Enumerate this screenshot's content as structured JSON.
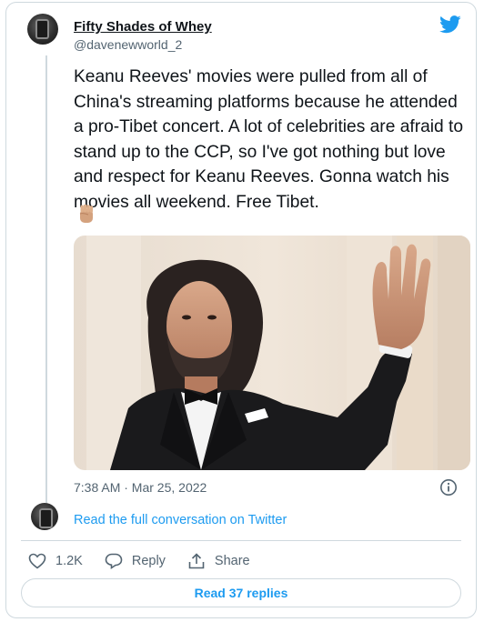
{
  "tweet": {
    "author_name": "Fifty Shades of Whey",
    "author_handle": "@davenewworld_2",
    "text": "Keanu Reeves' movies were pulled from all of China's streaming platforms because he attended a pro-Tibet concert. A lot of celebrities are afraid to stand up to the CCP, so I've got nothing but love and respect for Keanu Reeves. Gonna watch his movies all weekend. Free Tibet.",
    "emoji": "raised-fist-medium-skin-tone",
    "timestamp": "7:38 AM · Mar 25, 2022"
  },
  "footer": {
    "read_full": "Read the full conversation on Twitter",
    "like_count": "1.2K",
    "reply_label": "Reply",
    "share_label": "Share",
    "read_replies": "Read 37 replies"
  },
  "colors": {
    "twitter_blue": "#1d9bf0",
    "muted": "#536471",
    "border": "#cfd9de"
  }
}
